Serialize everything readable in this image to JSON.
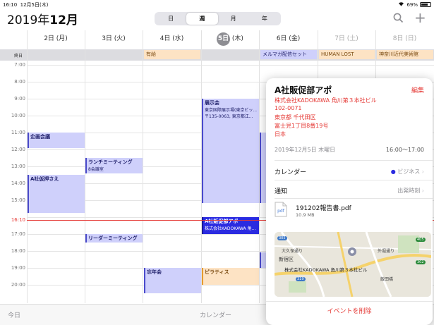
{
  "status_bar": {
    "time": "16:10",
    "date": "12月5日(木)",
    "battery": "69%",
    "battery_level": 0.69
  },
  "header": {
    "year": "2019年",
    "month": "12月",
    "view_tabs": [
      {
        "label": "日",
        "active": false
      },
      {
        "label": "週",
        "active": true
      },
      {
        "label": "月",
        "active": false
      },
      {
        "label": "年",
        "active": false
      }
    ]
  },
  "days": [
    {
      "label": "2日 (月)",
      "today": false,
      "weekend": false
    },
    {
      "label": "3日 (火)",
      "today": false,
      "weekend": false
    },
    {
      "label": "4日 (水)",
      "today": false,
      "weekend": false
    },
    {
      "num": "5日",
      "wd": "(木)",
      "today": true,
      "weekend": false
    },
    {
      "label": "6日 (金)",
      "today": false,
      "weekend": false
    },
    {
      "label": "7日 (土)",
      "today": false,
      "weekend": true
    },
    {
      "label": "8日 (日)",
      "today": false,
      "weekend": true
    }
  ],
  "allday": {
    "label": "終日",
    "events": [
      {
        "title": "有給"
      },
      {
        "title": "メルマガ配信セット"
      },
      {
        "title": "HUMAN LOST"
      },
      {
        "title": "神奈川近代美術館"
      }
    ]
  },
  "hours": [
    "7:00",
    "8:00",
    "9:00",
    "10:00",
    "11:00",
    "12:00",
    "13:00",
    "14:00",
    "15:00",
    "16:00",
    "17:00",
    "18:00",
    "19:00",
    "20:00"
  ],
  "now_label": "16:10",
  "events": [
    {
      "title": "企画会議",
      "sub": ""
    },
    {
      "title": "ランチミーティング",
      "sub": "8会議室"
    },
    {
      "title": "A社仮押さえ",
      "sub": ""
    },
    {
      "title": "展示会",
      "sub": "東京国際展示場(東京ビッ...",
      "sub2": "〒135-0063, 東京都江..."
    },
    {
      "title": "A社販促部アポ",
      "sub": "株式会社KADOKAWA 角..."
    },
    {
      "title": "リーダーミーティング",
      "sub": ""
    },
    {
      "title": "忘年会",
      "sub": ""
    },
    {
      "title": "ピラティス",
      "sub": ""
    }
  ],
  "popover": {
    "title": "A社販促部アポ",
    "edit": "編集",
    "address": [
      "株式会社KADOKAWA 角川第３本社ビル",
      "102-0071",
      "東京都 千代田区",
      "富士見1丁目8番19号",
      "日本"
    ],
    "date": "2019年12月5日 木曜日",
    "time": "16:00～17:00",
    "calendar_label": "カレンダー",
    "calendar_value": "ビジネス",
    "notify_label": "通知",
    "notify_value": "出発時刻",
    "attachment_name": "191202報告書.pdf",
    "attachment_size": "10.9 MB",
    "attachment_icon_text": "pdf",
    "map_label": "株式会社KADOKAWA 角川第３本社ビル",
    "map_places": [
      "大久保通り",
      "新宿区",
      "外堀通り",
      "飯田橋"
    ],
    "map_routes": [
      "305",
      "319",
      "405",
      "302"
    ],
    "delete": "イベントを削除"
  },
  "bottom": {
    "today": "今日",
    "calendar": "カレンダー"
  },
  "colors": {
    "accent": "#e53935",
    "event": "#cfd0fb",
    "event_border": "#4a4acb",
    "orange": "#fde3c4",
    "calendar_dot": "#2b2be0"
  }
}
